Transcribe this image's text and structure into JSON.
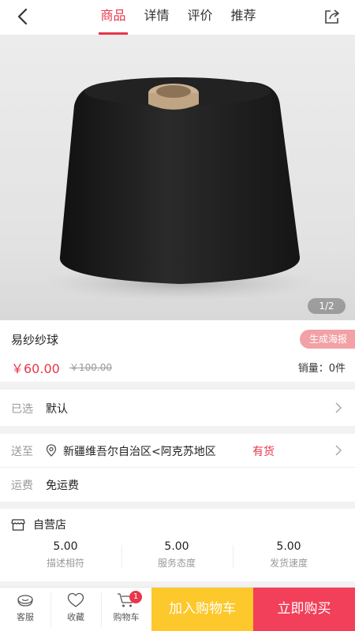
{
  "header": {
    "tabs": [
      {
        "label": "商品",
        "active": true
      },
      {
        "label": "详情",
        "active": false
      },
      {
        "label": "评价",
        "active": false
      },
      {
        "label": "推荐",
        "active": false
      }
    ]
  },
  "gallery": {
    "pager": "1/2"
  },
  "product": {
    "title": "易纱纱球",
    "poster_label": "生成海报",
    "price": "￥60.00",
    "original_price": "￥100.00",
    "sales": "销量：0件"
  },
  "selection": {
    "label": "已选",
    "value": "默认"
  },
  "delivery": {
    "label": "送至",
    "address": "新疆维吾尔自治区<阿克苏地区",
    "stock": "有货"
  },
  "shipping": {
    "label": "运费",
    "value": "免运费"
  },
  "store": {
    "name": "自营店",
    "scores": [
      {
        "value": "5.00",
        "label": "描述相符"
      },
      {
        "value": "5.00",
        "label": "服务态度"
      },
      {
        "value": "5.00",
        "label": "发货速度"
      }
    ]
  },
  "bottom_bar": {
    "service": "客服",
    "favorite": "收藏",
    "cart": "购物车",
    "cart_count": "1",
    "add_to_cart": "加入购物车",
    "buy_now": "立即购买"
  },
  "colors": {
    "accent": "#e8364a",
    "add_to_cart_bg": "#fcc82b",
    "buy_now_bg": "#f23f5a",
    "poster_bg": "#f2a1a6"
  }
}
